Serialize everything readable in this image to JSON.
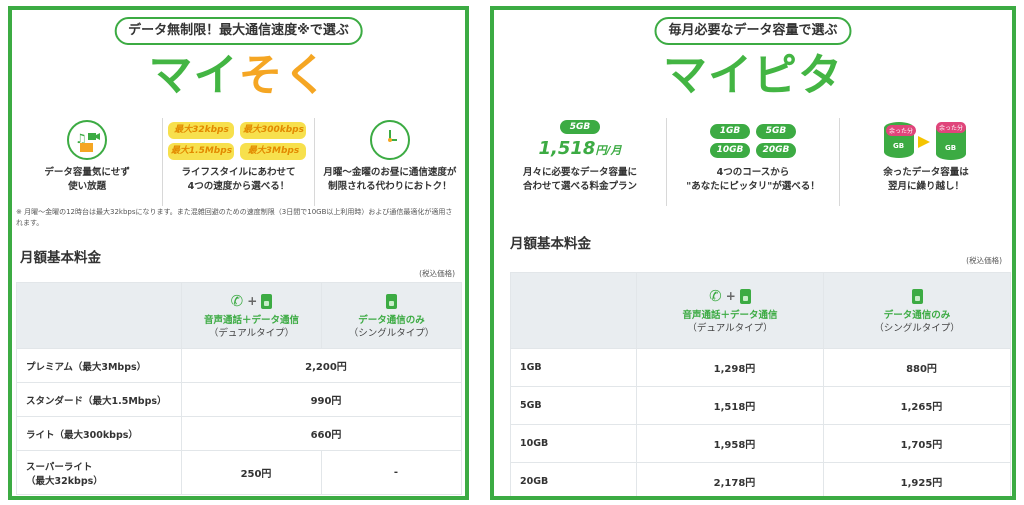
{
  "left": {
    "header_pill": "データ無制限！最大通信速度※で選ぶ",
    "logo": {
      "part1": "マイ",
      "part2": "そく"
    },
    "features": [
      {
        "text_lines": [
          "データ容量気にせず",
          "使い放題"
        ]
      },
      {
        "text_lines": [
          "ライフスタイルにあわせて",
          "4つの速度から選べる！"
        ],
        "speeds": [
          "最大32kbps",
          "最大300kbps",
          "最大1.5Mbps",
          "最大3Mbps"
        ]
      },
      {
        "text_lines": [
          "月曜～金曜のお昼に通信速度が",
          "制限される代わりにおトク！"
        ]
      }
    ],
    "note": "※ 月曜～金曜の12時台は最大32kbpsになります。また混雑回避のための速度制限（3日間で10GB以上利用時）および通信最適化が適用されます。",
    "section_title": "月額基本料金",
    "tax_note": "(税込価格)",
    "table": {
      "col1": {
        "title": "音声通話＋データ通信",
        "subtitle": "（デュアルタイプ）"
      },
      "col2": {
        "title": "データ通信のみ",
        "subtitle": "（シングルタイプ）"
      },
      "rows": [
        {
          "plan": "プレミアム（最大3Mbps）",
          "price": "2,200円"
        },
        {
          "plan": "スタンダード（最大1.5Mbps）",
          "price": "990円"
        },
        {
          "plan": "ライト（最大300kbps）",
          "price": "660円"
        },
        {
          "plan_line1": "スーパーライト",
          "plan_line2": "（最大32kbps）",
          "dual": "250円",
          "single": "-"
        }
      ]
    }
  },
  "right": {
    "header_pill": "毎月必要なデータ容量で選ぶ",
    "logo": "マイピタ",
    "features": [
      {
        "badge": "5GB",
        "price": "1,518",
        "unit": "円/月",
        "text_lines": [
          "月々に必要なデータ容量に",
          "合わせて選べる料金プラン"
        ]
      },
      {
        "chips": [
          "1GB",
          "5GB",
          "10GB",
          "20GB"
        ],
        "text_lines": [
          "4つのコースから",
          "\"あなたにピッタリ\"が選べる！"
        ]
      },
      {
        "tag_left": "余った分",
        "tag_right": "余った分",
        "db_left": "GB",
        "db_right": "GB",
        "text_lines": [
          "余ったデータ容量は",
          "翌月に繰り越し！"
        ]
      }
    ],
    "section_title": "月額基本料金",
    "tax_note": "(税込価格)",
    "table": {
      "col1": {
        "title": "音声通話＋データ通信",
        "subtitle": "（デュアルタイプ）"
      },
      "col2": {
        "title": "データ通信のみ",
        "subtitle": "（シングルタイプ）"
      },
      "rows": [
        {
          "plan": "1GB",
          "dual": "1,298円",
          "single": "880円"
        },
        {
          "plan": "5GB",
          "dual": "1,518円",
          "single": "1,265円"
        },
        {
          "plan": "10GB",
          "dual": "1,958円",
          "single": "1,705円"
        },
        {
          "plan": "20GB",
          "dual": "2,178円",
          "single": "1,925円"
        }
      ]
    }
  },
  "colors": {
    "brand_green": "#3cab43",
    "accent_orange": "#f5a623",
    "speed_chip": "#f7e04d",
    "table_header": "#e9edf0",
    "db_pink": "#e0457b"
  }
}
